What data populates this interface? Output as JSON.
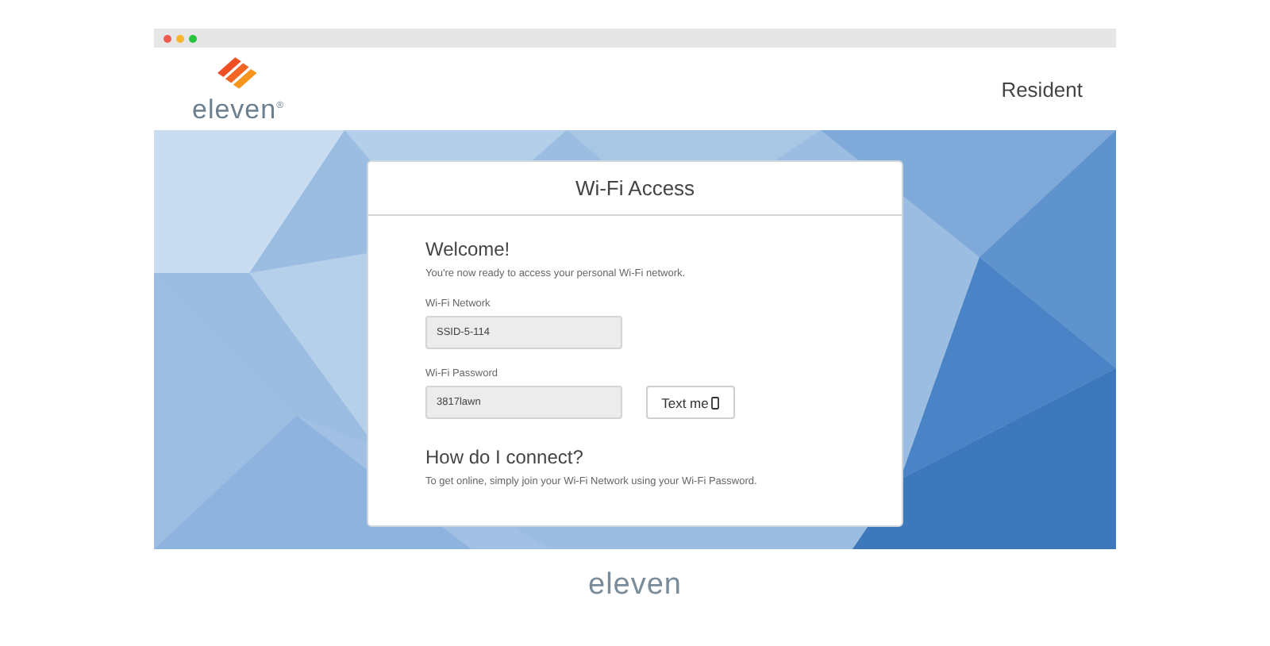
{
  "header": {
    "logo_text": "eleven$^{®}$",
    "user_label": "Resident"
  },
  "card": {
    "title": "Wi-Fi Access",
    "heading": "Welcome!",
    "intro": "You're now ready to access your personal Wi-Fi network.",
    "fields": [
      {
        "label": "Wi-Fi Network",
        "value": "SSID-5-114"
      },
      {
        "label": "Wi-Fi Password",
        "value": "3817lawn"
      }
    ],
    "text_button": "Text me",
    "help_heading": "How do I connect?",
    "help_text": "To get online, simply join your Wi-Fi Network using your Wi-Fi Password."
  },
  "footer": {
    "logo_text": "eleven"
  }
}
